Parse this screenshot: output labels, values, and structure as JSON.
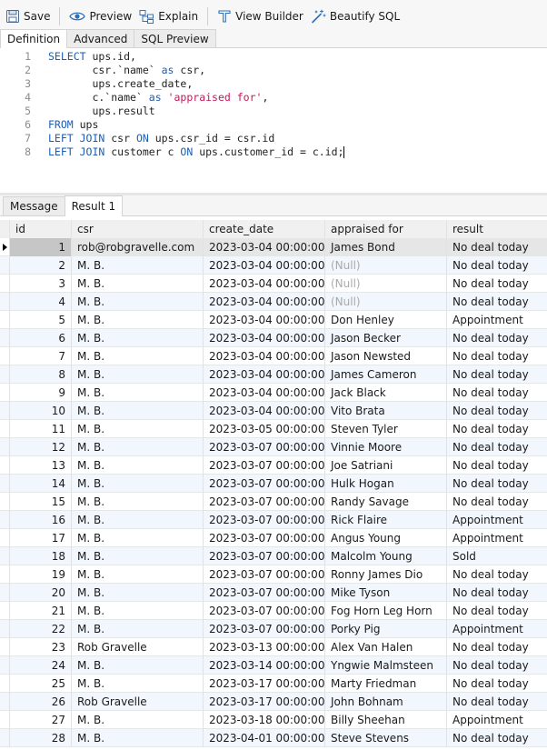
{
  "toolbar": {
    "save": "Save",
    "preview": "Preview",
    "explain": "Explain",
    "view_builder": "View Builder",
    "beautify": "Beautify SQL"
  },
  "editor_tabs": [
    "Definition",
    "Advanced",
    "SQL Preview"
  ],
  "sql": [
    {
      "n": "1",
      "parts": [
        {
          "t": "SELECT",
          "k": "kw"
        },
        {
          "t": " ups.id,"
        }
      ]
    },
    {
      "n": "2",
      "parts": [
        {
          "t": "       csr.`name` "
        },
        {
          "t": "as",
          "k": "kw"
        },
        {
          "t": " csr,"
        }
      ]
    },
    {
      "n": "3",
      "parts": [
        {
          "t": "       ups.create_date,"
        }
      ]
    },
    {
      "n": "4",
      "parts": [
        {
          "t": "       c.`name` "
        },
        {
          "t": "as",
          "k": "kw"
        },
        {
          "t": " "
        },
        {
          "t": "'appraised for'",
          "k": "str"
        },
        {
          "t": ","
        }
      ]
    },
    {
      "n": "5",
      "parts": [
        {
          "t": "       ups.result"
        }
      ]
    },
    {
      "n": "6",
      "parts": [
        {
          "t": "FROM",
          "k": "kw"
        },
        {
          "t": " ups"
        }
      ]
    },
    {
      "n": "7",
      "parts": [
        {
          "t": "LEFT JOIN",
          "k": "kw"
        },
        {
          "t": " csr "
        },
        {
          "t": "ON",
          "k": "kw"
        },
        {
          "t": " ups.csr_id = csr.id"
        }
      ]
    },
    {
      "n": "8",
      "parts": [
        {
          "t": "LEFT JOIN",
          "k": "kw"
        },
        {
          "t": " customer c "
        },
        {
          "t": "ON",
          "k": "kw"
        },
        {
          "t": " ups.customer_id = c.id;"
        }
      ]
    }
  ],
  "result_tabs": [
    "Message",
    "Result 1"
  ],
  "columns": [
    "id",
    "csr",
    "create_date",
    "appraised for",
    "result"
  ],
  "null_text": "(Null)",
  "rows": [
    [
      "1",
      "rob@robgravelle.com",
      "2023-03-04 00:00:00",
      "James Bond",
      "No deal today"
    ],
    [
      "2",
      "M. B.",
      "2023-03-04 00:00:00",
      null,
      "No deal today"
    ],
    [
      "3",
      "M. B.",
      "2023-03-04 00:00:00",
      null,
      "No deal today"
    ],
    [
      "4",
      "M. B.",
      "2023-03-04 00:00:00",
      null,
      "No deal today"
    ],
    [
      "5",
      "M. B.",
      "2023-03-04 00:00:00",
      "Don Henley",
      "Appointment"
    ],
    [
      "6",
      "M. B.",
      "2023-03-04 00:00:00",
      "Jason Becker",
      "No deal today"
    ],
    [
      "7",
      "M. B.",
      "2023-03-04 00:00:00",
      "Jason Newsted",
      "No deal today"
    ],
    [
      "8",
      "M. B.",
      "2023-03-04 00:00:00",
      "James Cameron",
      "No deal today"
    ],
    [
      "9",
      "M. B.",
      "2023-03-04 00:00:00",
      "Jack Black",
      "No deal today"
    ],
    [
      "10",
      "M. B.",
      "2023-03-04 00:00:00",
      "Vito Brata",
      "No deal today"
    ],
    [
      "11",
      "M. B.",
      "2023-03-05 00:00:00",
      "Steven Tyler",
      "No deal today"
    ],
    [
      "12",
      "M. B.",
      "2023-03-07 00:00:00",
      "Vinnie Moore",
      "No deal today"
    ],
    [
      "13",
      "M. B.",
      "2023-03-07 00:00:00",
      "Joe Satriani",
      "No deal today"
    ],
    [
      "14",
      "M. B.",
      "2023-03-07 00:00:00",
      "Hulk Hogan",
      "No deal today"
    ],
    [
      "15",
      "M. B.",
      "2023-03-07 00:00:00",
      "Randy Savage",
      "No deal today"
    ],
    [
      "16",
      "M. B.",
      "2023-03-07 00:00:00",
      "Rick Flaire",
      "Appointment"
    ],
    [
      "17",
      "M. B.",
      "2023-03-07 00:00:00",
      "Angus Young",
      "Appointment"
    ],
    [
      "18",
      "M. B.",
      "2023-03-07 00:00:00",
      "Malcolm Young",
      "Sold"
    ],
    [
      "19",
      "M. B.",
      "2023-03-07 00:00:00",
      "Ronny James Dio",
      "No deal today"
    ],
    [
      "20",
      "M. B.",
      "2023-03-07 00:00:00",
      "Mike Tyson",
      "No deal today"
    ],
    [
      "21",
      "M. B.",
      "2023-03-07 00:00:00",
      "Fog Horn Leg Horn",
      "No deal today"
    ],
    [
      "22",
      "M. B.",
      "2023-03-07 00:00:00",
      "Porky Pig",
      "Appointment"
    ],
    [
      "23",
      "Rob Gravelle",
      "2023-03-13 00:00:00",
      "Alex Van Halen",
      "No deal today"
    ],
    [
      "24",
      "M. B.",
      "2023-03-14 00:00:00",
      "Yngwie Malmsteen",
      "No deal today"
    ],
    [
      "25",
      "M. B.",
      "2023-03-17 00:00:00",
      "Marty Friedman",
      "No deal today"
    ],
    [
      "26",
      "Rob Gravelle",
      "2023-03-17 00:00:00",
      "John Bohnam",
      "No deal today"
    ],
    [
      "27",
      "M. B.",
      "2023-03-18 00:00:00",
      "Billy Sheehan",
      "Appointment"
    ],
    [
      "28",
      "M. B.",
      "2023-04-01 00:00:00",
      "Steve Stevens",
      "No deal today"
    ]
  ],
  "colors": {
    "accent": "#1a5fb4",
    "string": "#c2185b",
    "null": "#a9a9a9",
    "alt_row": "#f2f7fd"
  },
  "icons": [
    "save-icon",
    "eye-icon",
    "explain-icon",
    "view-builder-icon",
    "beautify-icon",
    "row-pointer-icon"
  ]
}
